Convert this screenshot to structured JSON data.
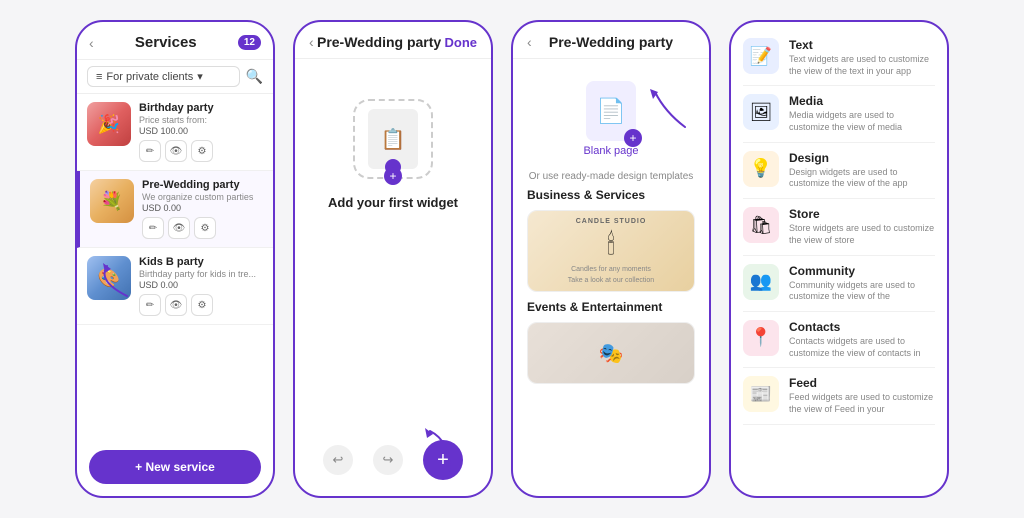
{
  "phone1": {
    "back_icon": "‹",
    "title": "Services",
    "badge": "12",
    "filter_label": "For private clients",
    "filter_chevron": "▾",
    "search_icon": "🔍",
    "services": [
      {
        "name": "Birthday party",
        "desc_line1": "Price starts from:",
        "price": "USD 100.00",
        "emoji": "🎉"
      },
      {
        "name": "Pre-Wedding party",
        "desc_line1": "We organize custom parties",
        "price": "USD 0.00",
        "emoji": "💐"
      },
      {
        "name": "Kids B party",
        "desc_line1": "Birthday party for kids in tre...",
        "price": "USD 0.00",
        "emoji": "🎨"
      }
    ],
    "edit_icon": "✏",
    "eye_icon": "👁",
    "gear_icon": "⚙",
    "new_service_label": "+ New service"
  },
  "phone2": {
    "back_icon": "‹",
    "title": "Pre-Wedding party",
    "done_label": "Done",
    "add_widget_label": "Add your first widget",
    "undo_icon": "↩",
    "redo_icon": "↪",
    "add_icon": "+"
  },
  "phone3": {
    "back_icon": "‹",
    "title": "Pre-Wedding party",
    "blank_page_label": "Blank page",
    "or_text": "Or use ready-made design templates",
    "section1_title": "Business & Services",
    "candle_studio_label": "CANDLE STUDIO",
    "candle_product_label": "Candles for any moments",
    "candle_sub_label": "Take a look at our collection",
    "section2_title": "Events & Entertainment"
  },
  "phone4": {
    "widgets": [
      {
        "name": "Text",
        "desc": "Text widgets are used to customize the view of the text in your app",
        "icon": "📝",
        "icon_class": "wi-text"
      },
      {
        "name": "Media",
        "desc": "Media widgets are used to customize the view of media",
        "icon": "🖼",
        "icon_class": "wi-media"
      },
      {
        "name": "Design",
        "desc": "Design widgets are used to customize the view of the app",
        "icon": "💡",
        "icon_class": "wi-design"
      },
      {
        "name": "Store",
        "desc": "Store widgets are used to customize the view of store",
        "icon": "🛍",
        "icon_class": "wi-store"
      },
      {
        "name": "Community",
        "desc": "Community widgets are used to customize the view of the",
        "icon": "👥",
        "icon_class": "wi-community"
      },
      {
        "name": "Contacts",
        "desc": "Contacts widgets are used to customize the view of contacts in",
        "icon": "📍",
        "icon_class": "wi-contacts"
      },
      {
        "name": "Feed",
        "desc": "Feed widgets are used to customize the view of Feed in your",
        "icon": "📰",
        "icon_class": "wi-feed"
      }
    ]
  }
}
